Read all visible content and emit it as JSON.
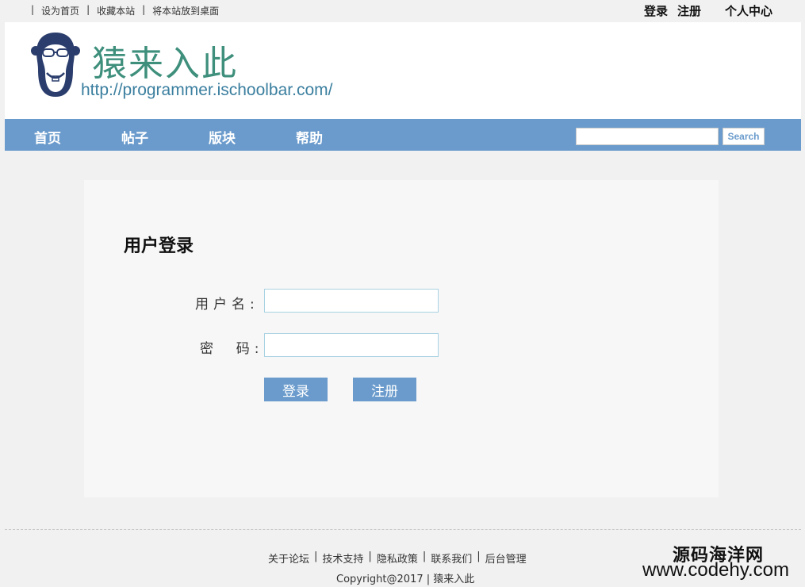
{
  "topbar": {
    "links": [
      "设为首页",
      "收藏本站",
      "将本站放到桌面"
    ],
    "login": "登录",
    "register": "注册",
    "user_center": "个人中心"
  },
  "header": {
    "site_title": "猿来入此",
    "site_url": "http://programmer.ischoolbar.com/",
    "logo_icon": "monkey-logo-icon"
  },
  "nav": {
    "items": [
      "首页",
      "帖子",
      "版块",
      "帮助"
    ],
    "search_value": "",
    "search_button": "Search"
  },
  "login_form": {
    "heading": "用户登录",
    "username_label": "用户名:",
    "password_label": "密  码:",
    "username_value": "",
    "password_value": "",
    "login_button": "登录",
    "register_button": "注册"
  },
  "footer": {
    "links": [
      "关于论坛",
      "技术支持",
      "隐私政策",
      "联系我们",
      "后台管理"
    ],
    "copyright": "Copyright@2017 | 猿来入此"
  },
  "watermark": {
    "line1": "源码海洋网",
    "line2": "www.codehy.com"
  },
  "colors": {
    "nav_bg": "#6a9bcc",
    "title_green": "#3e8f7c",
    "url_blue": "#3b7f9f",
    "logo_navy": "#2a3d6c"
  }
}
